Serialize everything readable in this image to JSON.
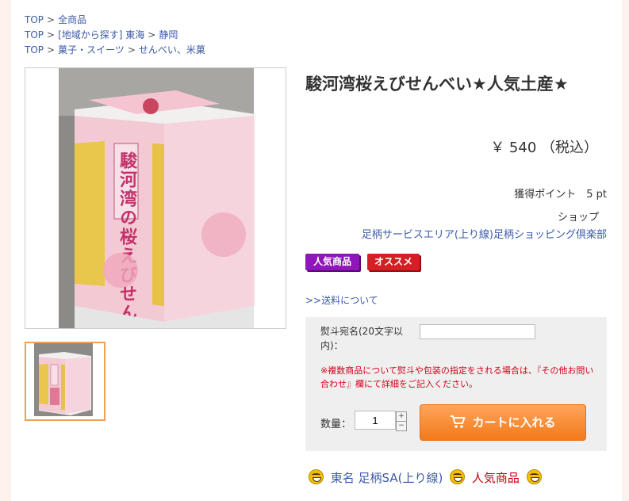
{
  "breadcrumbs": [
    {
      "items": [
        "TOP",
        "全商品"
      ]
    },
    {
      "items": [
        "TOP",
        "[地域から探す] 東海",
        "静岡"
      ]
    },
    {
      "items": [
        "TOP",
        "菓子・スイーツ",
        "せんべい、米菓"
      ]
    }
  ],
  "breadcrumb_separator": ">",
  "product": {
    "title": "駿河湾桜えびせんべい★人気土産★",
    "price": "￥ 540 （税込）",
    "points": "獲得ポイント　5 pt",
    "shop_label": "ショップ",
    "shop_name": "足柄サービスエリア(上り線)足柄ショッピング倶楽部",
    "badges": [
      "人気商品",
      "オススメ"
    ],
    "shipping_link": ">>送料について",
    "package_text": "駿河湾の桜えびせんべい"
  },
  "form": {
    "noshi_label": "熨斗宛名(20文字以内)：",
    "noshi_value": "",
    "note": "※複数商品について熨斗や包装の指定をされる場合は、『その他お問い合わせ』欄にて詳細をご記入ください。",
    "qty_label": "数量：",
    "qty_value": "1",
    "cart_button": "カートに入れる"
  },
  "tags": {
    "tag1": "東名 足柄SA(上り線)",
    "tag2": "人気商品"
  },
  "colors": {
    "accent": "#f27a1a",
    "link": "#3b5aa8",
    "badge_popular": "#8f16b8",
    "badge_recommend": "#d41f24",
    "note_red": "#d3001a"
  }
}
